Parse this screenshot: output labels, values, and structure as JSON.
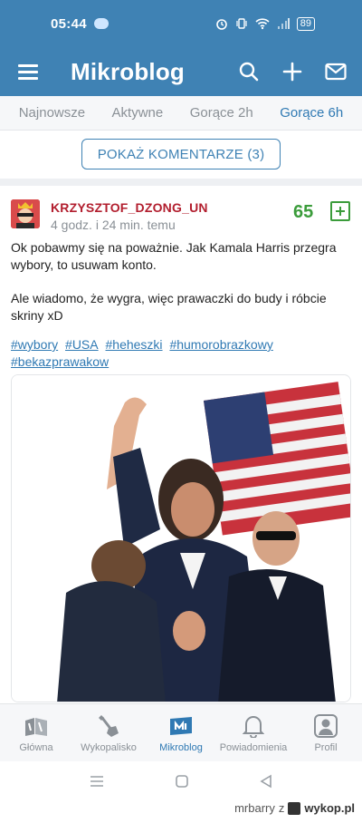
{
  "status_bar": {
    "time": "05:44",
    "battery": "89"
  },
  "app_bar": {
    "title": "Mikroblog"
  },
  "tabs": [
    {
      "label": "Najnowsze",
      "active": false
    },
    {
      "label": "Aktywne",
      "active": false
    },
    {
      "label": "Gorące 2h",
      "active": false
    },
    {
      "label": "Gorące 6h",
      "active": true
    }
  ],
  "comments_button": {
    "label": "POKAŻ KOMENTARZE (3)"
  },
  "post": {
    "author": "KRZYSZTOF_DZONG_UN",
    "time_ago": "4 godz. i 24 min. temu",
    "votes": "65",
    "paragraphs": [
      "Ok pobawmy się na poważnie. Jak Kamala Harris przegra wybory, to usuwam konto.",
      "Ale wiadomo, że wygra, więc prawaczki do budy i róbcie skriny xD"
    ],
    "tags": [
      "#wybory",
      "#USA",
      "#heheszki",
      "#humorobrazkowy",
      "#bekazprawakow"
    ]
  },
  "bottom_nav": [
    {
      "label": "Główna",
      "icon": "home-icon",
      "active": false
    },
    {
      "label": "Wykopalisko",
      "icon": "shovel-icon",
      "active": false
    },
    {
      "label": "Mikroblog",
      "icon": "mikroblog-icon",
      "active": true
    },
    {
      "label": "Powiadomienia",
      "icon": "bell-icon",
      "active": false
    },
    {
      "label": "Profil",
      "icon": "profile-icon",
      "active": false
    }
  ],
  "watermark": {
    "user": "mrbarry",
    "sep": "z",
    "site": "wykop.pl"
  },
  "colors": {
    "primary": "#3f82b4",
    "upvote": "#3b9c3b",
    "author": "#b21e2e"
  }
}
